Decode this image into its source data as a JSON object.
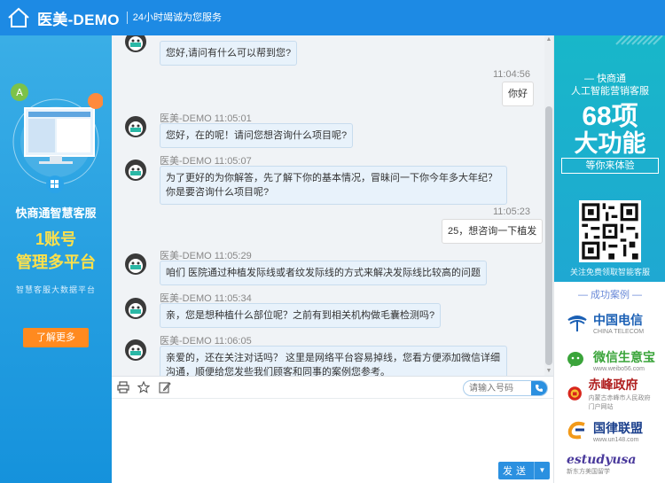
{
  "header": {
    "title": "医美-DEMO",
    "slogan": "24小时竭诚为您服务"
  },
  "left_promo": {
    "title": "快商通智慧客服",
    "big_line1": "1账号",
    "big_line2": "管理多平台",
    "subtitle": "智慧客服大数据平台",
    "button": "了解更多"
  },
  "messages": [
    {
      "side": "agent",
      "meta": "",
      "text": "您好,请问有什么可以帮到您?"
    },
    {
      "side": "user",
      "time": "11:04:56",
      "text": "你好"
    },
    {
      "side": "agent",
      "meta": "医美-DEMO 11:05:01",
      "text": "您好，在的呢！请问您想咨询什么项目呢?"
    },
    {
      "side": "agent",
      "meta": "医美-DEMO 11:05:07",
      "text": "为了更好的为你解答，先了解下你的基本情况，冒昧问一下你今年多大年纪？你是要咨询什么项目呢?"
    },
    {
      "side": "user",
      "time": "11:05:23",
      "text": "25，想咨询一下植发"
    },
    {
      "side": "agent",
      "meta": "医美-DEMO 11:05:29",
      "text": "咱们 医院通过种植发际线或者纹发际线的方式来解决发际线比较高的问题"
    },
    {
      "side": "agent",
      "meta": "医美-DEMO 11:05:34",
      "text": "亲，您是想种植什么部位呢？之前有到相关机构做毛囊检测吗?"
    },
    {
      "side": "agent",
      "meta": "医美-DEMO 11:06:05",
      "text": "亲爱的，还在关注对话吗？ 这里是网络平台容易掉线，您看方便添加微信详细沟通，顺便给您发些我们顾客和同事的案例您参考。"
    }
  ],
  "toolbar": {
    "phone_placeholder": "请输入号码",
    "send_label": "发送"
  },
  "right_promo": {
    "brand": "快商通",
    "line2": "人工智能营销客服",
    "big1": "68项",
    "big2": "大功能",
    "cta": "等你来体验",
    "qr_caption": "关注免费领取智能客服",
    "cases_title": "成功案例"
  },
  "cases": [
    {
      "name": "中国电信",
      "sub": "CHINA TELECOM",
      "color": "#1a5fb4"
    },
    {
      "name": "微信生意宝",
      "sub": "www.weibo56.com",
      "color": "#3aa43a"
    },
    {
      "name": "赤峰政府",
      "sub": "内蒙古赤峰市人民政府门户网站",
      "color": "#b02020"
    },
    {
      "name": "国律联盟",
      "sub": "www.un148.com",
      "color": "#1a3f8c"
    },
    {
      "name": "estudyusa",
      "sub": "新东方美国留学",
      "color": "#4a3a9c"
    }
  ]
}
